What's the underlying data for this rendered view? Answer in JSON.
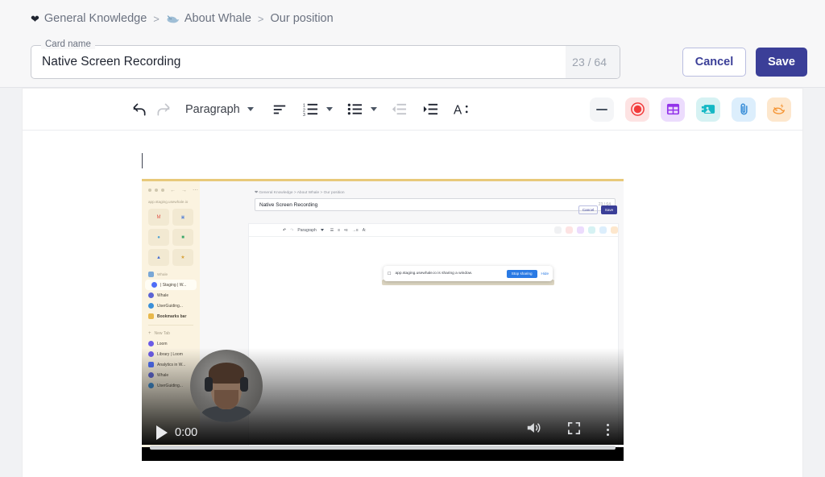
{
  "breadcrumb": {
    "items": [
      {
        "label": "General Knowledge",
        "icon": "heart-icon"
      },
      {
        "label": "About Whale",
        "icon": "whale-icon"
      },
      {
        "label": "Our position",
        "icon": ""
      }
    ],
    "separator": ">"
  },
  "card_name_field": {
    "legend": "Card name",
    "value": "Native Screen Recording",
    "placeholder": "Card name",
    "char_count": "23 / 64"
  },
  "header_actions": {
    "cancel_label": "Cancel",
    "save_label": "Save",
    "save_bg": "#3b3f98",
    "cancel_fg": "#3b3f98"
  },
  "toolbar": {
    "undo": "undo-icon",
    "redo": "redo-icon",
    "block_style": "Paragraph",
    "align": "align-left-icon",
    "ordered_list": "ordered-list-icon",
    "bullet_list": "bullet-list-icon",
    "outdent": "outdent-icon",
    "indent": "indent-icon",
    "text_format": "A:",
    "chips": [
      {
        "name": "horizontal-rule-icon",
        "bg": "#f4f5f7",
        "fg": "#4b5563"
      },
      {
        "name": "record-icon",
        "bg": "#fde3e3",
        "fg": "#f23b3b"
      },
      {
        "name": "table-icon",
        "bg": "#ecdcfd",
        "fg": "#9333ea"
      },
      {
        "name": "image-icon",
        "bg": "#d6f2f3",
        "fg": "#14b8c4"
      },
      {
        "name": "attachment-icon",
        "bg": "#dceefc",
        "fg": "#3b8fd8"
      },
      {
        "name": "whale-ai-icon",
        "bg": "#fde7cd",
        "fg": "#f59432"
      }
    ]
  },
  "video": {
    "time": "0:00",
    "play_icon": "play-icon",
    "volume_icon": "volume-icon",
    "fullscreen_icon": "fullscreen-icon",
    "menu_icon": "kebab-menu-icon",
    "progress_percent": 100,
    "inner": {
      "url": "app.staging.usewhale.io",
      "breadcrumb": "General Knowledge  >  About Whale  >  Our position",
      "card_legend": "Card name",
      "card_value": "Native Screen Recording",
      "char_count": "23 / 64",
      "cancel_label": "Cancel",
      "save_label": "Save",
      "block_style": "Paragraph",
      "share_message": "app.staging.usewhale.io is sharing a window.",
      "share_stop": "Stop sharing",
      "share_hide": "Hide",
      "sidebar_items": [
        {
          "label": "| Staging | W...",
          "color": "#4f6ef7",
          "active": true
        },
        {
          "label": "Whale",
          "color": "#5b63d3",
          "active": false
        },
        {
          "label": "UserGuiding...",
          "color": "#3b8fd8",
          "active": false
        },
        {
          "label": "Bookmarks bar",
          "color": "#e8b84b",
          "active": false
        },
        {
          "label": "New Tab",
          "color": "#c9c2ae",
          "active": false
        },
        {
          "label": "Loom",
          "color": "#6c5ce7",
          "active": false
        },
        {
          "label": "Library | Loom",
          "color": "#6c5ce7",
          "active": false
        },
        {
          "label": "Analytics in W...",
          "color": "#4f6ef7",
          "active": false
        },
        {
          "label": "Whale",
          "color": "#5b63d3",
          "active": false
        },
        {
          "label": "UserGuiding...",
          "color": "#3b8fd8",
          "active": false
        }
      ],
      "sidebar_section": "Whale"
    }
  }
}
